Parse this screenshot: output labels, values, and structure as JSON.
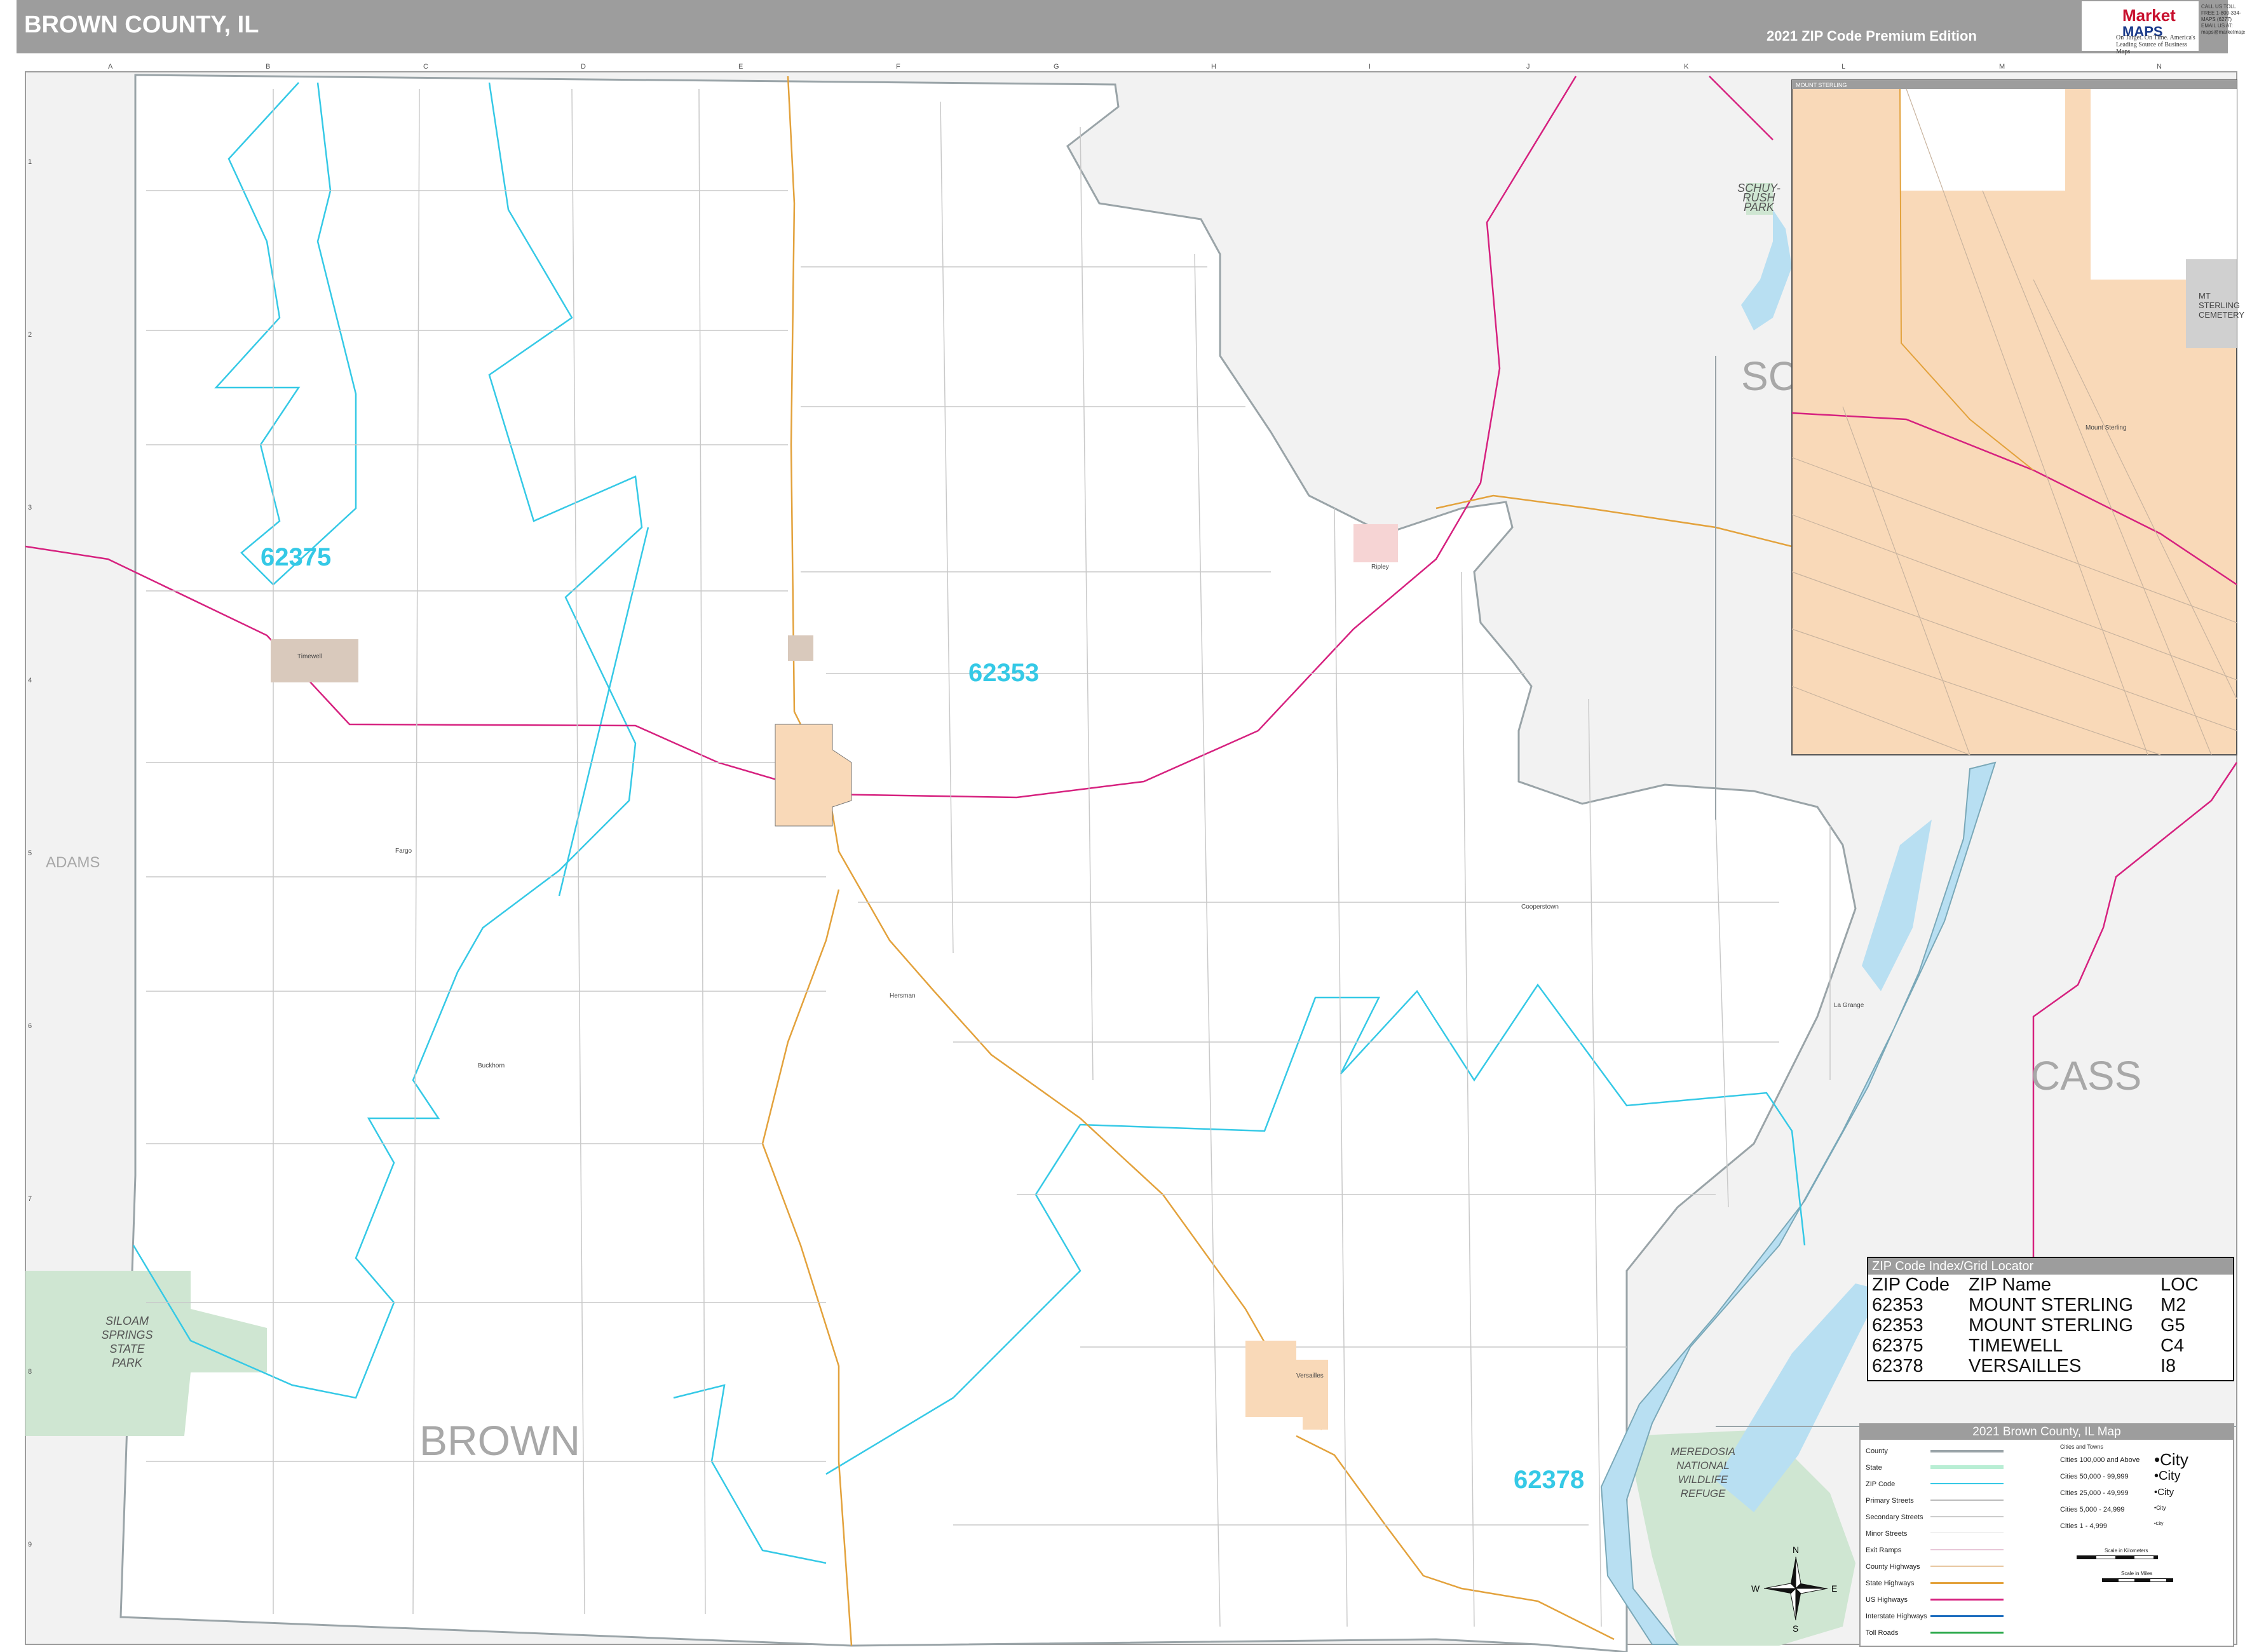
{
  "header": {
    "title": "BROWN COUNTY, IL",
    "edition": "2021 ZIP Code Premium Edition",
    "logo_text_1": "Market",
    "logo_text_2": "MAPS",
    "logo_tagline": "On Target. On Time. America's Leading Source of Business Maps",
    "logo_contact": "CALL US TOLL FREE 1-800-334-MAPS (6277) EMAIL US AT: maps@marketmaps.com"
  },
  "grid": {
    "columns": [
      "A",
      "B",
      "C",
      "D",
      "E",
      "F",
      "G",
      "H",
      "I",
      "J",
      "K",
      "L",
      "M",
      "N"
    ],
    "rows": [
      "1",
      "2",
      "3",
      "4",
      "5",
      "6",
      "7",
      "8",
      "9"
    ]
  },
  "map": {
    "county_labels": {
      "brown": "BROWN",
      "adams": "ADAMS",
      "cass": "CASS",
      "schuyler_partial": "SC"
    },
    "zip_labels": {
      "z62375": "62375",
      "z62353": "62353",
      "z62378": "62378"
    },
    "parks": {
      "siloam": "SILOAM SPRINGS STATE PARK",
      "schuy_rush": "SCHUY-RUSH PARK",
      "meredosia": "MEREDOSIA NATIONAL WILDLIFE REFUGE",
      "mt_sterling_cemetery": "MT STERLING CEMETERY"
    },
    "places": {
      "timewell": "Timewell",
      "fargo": "Fargo",
      "buckhorn": "Buckhorn",
      "cooperstown": "Cooperstown",
      "hersman": "Hersman",
      "la_grange": "La Grange",
      "versailles": "Versailles",
      "ripley": "Ripley",
      "mount_sterling": "Mount Sterling"
    },
    "inset_title": "MOUNT STERLING",
    "colors": {
      "zip_boundary": "#35c9e6",
      "us_highway": "#d6217f",
      "state_highway": "#e3a23c",
      "water": "#b8dff2",
      "river_outline": "#7aa8b8",
      "park": "#cfe6d2",
      "city_fill": "#f9d9b8",
      "outside_area": "#f2f2f2"
    }
  },
  "zip_index": {
    "header": "ZIP Code Index/Grid Locator",
    "columns": [
      "ZIP Code",
      "ZIP Name",
      "LOC"
    ],
    "rows": [
      [
        "62353",
        "MOUNT STERLING",
        "M2"
      ],
      [
        "62353",
        "MOUNT STERLING",
        "G5"
      ],
      [
        "62375",
        "TIMEWELL",
        "C4"
      ],
      [
        "62378",
        "VERSAILLES",
        "I8"
      ]
    ]
  },
  "legend": {
    "header": "2021 Brown County, IL Map",
    "line_items": [
      "County",
      "State",
      "ZIP Code",
      "Primary Streets",
      "Secondary Streets",
      "Minor Streets",
      "Exit Ramps",
      "County Highways",
      "State Highways",
      "US Highways",
      "Interstate Highways",
      "Toll Roads"
    ],
    "cities_header": "Cities and Towns",
    "city_sizes": [
      "Cities 100,000 and Above",
      "Cities 50,000 - 99,999",
      "Cities 25,000 - 49,999",
      "Cities 5,000 - 24,999",
      "Cities 1 - 4,999"
    ],
    "city_symbols": [
      "City",
      "City",
      "City",
      "City",
      "City"
    ],
    "scale_km": "Scale in Kilometers",
    "scale_mi": "Scale in Miles"
  },
  "compass": {
    "n": "N",
    "s": "S",
    "e": "E",
    "w": "W"
  }
}
